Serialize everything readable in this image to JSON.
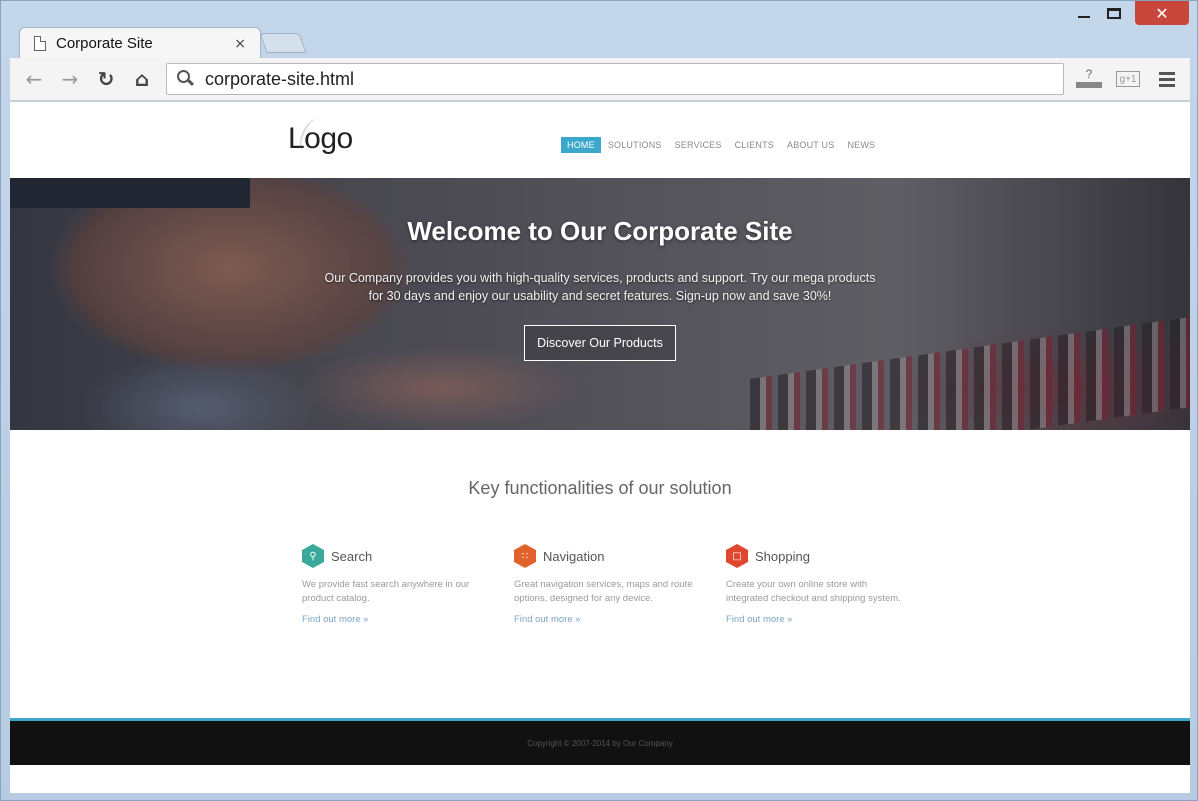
{
  "browser": {
    "tab_title": "Corporate Site",
    "tab_close": "×",
    "url": "corporate-site.html",
    "window_controls": {
      "close": "✕"
    },
    "icons": [
      "back-icon",
      "forward-icon",
      "reload-icon",
      "home-icon",
      "search-icon",
      "extension-icon",
      "google-plus-icon",
      "menu-icon"
    ],
    "ext_label": "?",
    "gplus_label": "g+1"
  },
  "site": {
    "logo": "Logo",
    "nav": [
      "HOME",
      "SOLUTIONS",
      "SERVICES",
      "CLIENTS",
      "ABOUT US",
      "NEWS"
    ],
    "active_nav": "HOME",
    "hero": {
      "title": "Welcome to Our Corporate Site",
      "text": "Our Company provides you with high-quality services, products and support. Try our mega products for 30 days and enjoy our usability and secret features. Sign-up now and save 30%!",
      "button": "Discover Our Products"
    },
    "features_title": "Key functionalities of our solution",
    "features": [
      {
        "name": "Search",
        "icon": "search-icon",
        "color": "#3aa89a",
        "desc": "We provide fast search anywhere in our product catalog.",
        "more": "Find out more »"
      },
      {
        "name": "Navigation",
        "icon": "grid-icon",
        "color": "#e2622c",
        "desc": "Great navigation services, maps and route options, designed for any device.",
        "more": "Find out more »"
      },
      {
        "name": "Shopping",
        "icon": "shopping-bag-icon",
        "color": "#e0472f",
        "desc": "Create your own online store with integrated checkout and shipping system.",
        "more": "Find out more »"
      }
    ],
    "footer": "Copyright © 2007-2014 by Our Company"
  },
  "colors": {
    "accent": "#3ba7cb",
    "footer_bg": "#111111"
  }
}
